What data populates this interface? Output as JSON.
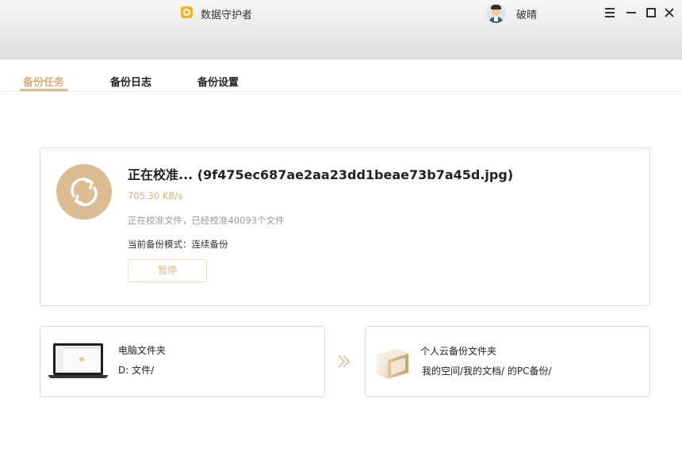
{
  "titlebar": {
    "app_title": "数据守护者",
    "username": "破晴",
    "logo_icon": "shield-logo-icon",
    "brand_color": "#f0b429"
  },
  "tabs": [
    {
      "label": "备份任务",
      "active": true
    },
    {
      "label": "备份日志",
      "active": false
    },
    {
      "label": "备份设置",
      "active": false
    }
  ],
  "task": {
    "title": "正在校准... (9f475ec687ae2aa23dd1beae73b7a45d.jpg)",
    "speed": "705.30 KB/s",
    "status": "正在校准文件，已经校准40093个文件",
    "mode": "当前备份模式：连续备份",
    "pause_label": "暂停",
    "accent_color": "#dbbc93"
  },
  "source": {
    "title": "电脑文件夹",
    "path": "D:         文件/"
  },
  "destination": {
    "title": "个人云备份文件夹",
    "path": "我的空间/我的文档/                   的PC备份/"
  }
}
